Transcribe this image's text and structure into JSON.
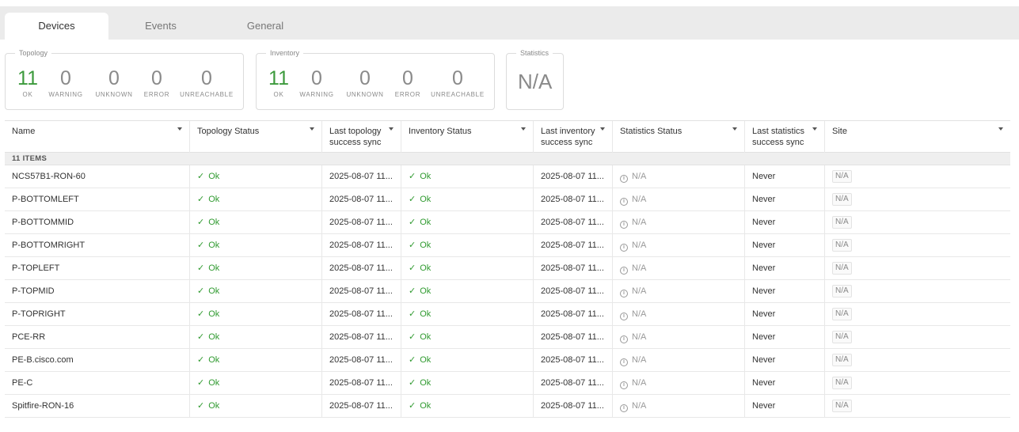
{
  "tabs": [
    {
      "label": "Devices",
      "active": true
    },
    {
      "label": "Events",
      "active": false
    },
    {
      "label": "General",
      "active": false
    }
  ],
  "topology": {
    "title": "Topology",
    "stats": [
      {
        "value": "11",
        "label": "OK"
      },
      {
        "value": "0",
        "label": "WARNING"
      },
      {
        "value": "0",
        "label": "UNKNOWN"
      },
      {
        "value": "0",
        "label": "ERROR"
      },
      {
        "value": "0",
        "label": "UNREACHABLE"
      }
    ]
  },
  "inventory": {
    "title": "Inventory",
    "stats": [
      {
        "value": "11",
        "label": "OK"
      },
      {
        "value": "0",
        "label": "WARNING"
      },
      {
        "value": "0",
        "label": "UNKNOWN"
      },
      {
        "value": "0",
        "label": "ERROR"
      },
      {
        "value": "0",
        "label": "UNREACHABLE"
      }
    ]
  },
  "statistics": {
    "title": "Statistics",
    "value": "N/A"
  },
  "table": {
    "columns": [
      {
        "line1": "Name",
        "line2": ""
      },
      {
        "line1": "Topology Status",
        "line2": ""
      },
      {
        "line1": "Last topology",
        "line2": "success sync"
      },
      {
        "line1": "Inventory Status",
        "line2": ""
      },
      {
        "line1": "Last inventory",
        "line2": "success sync"
      },
      {
        "line1": "Statistics Status",
        "line2": ""
      },
      {
        "line1": "Last statistics",
        "line2": "success sync"
      },
      {
        "line1": "Site",
        "line2": ""
      }
    ],
    "group_label": "11 ITEMS",
    "rows": [
      {
        "name": "NCS57B1-RON-60",
        "topology_status": "Ok",
        "last_topology_sync": "2025-08-07 11...",
        "inventory_status": "Ok",
        "last_inventory_sync": "2025-08-07 11...",
        "statistics_status": "N/A",
        "last_statistics_sync": "Never",
        "site": "N/A"
      },
      {
        "name": "P-BOTTOMLEFT",
        "topology_status": "Ok",
        "last_topology_sync": "2025-08-07 11...",
        "inventory_status": "Ok",
        "last_inventory_sync": "2025-08-07 11...",
        "statistics_status": "N/A",
        "last_statistics_sync": "Never",
        "site": "N/A"
      },
      {
        "name": "P-BOTTOMMID",
        "topology_status": "Ok",
        "last_topology_sync": "2025-08-07 11...",
        "inventory_status": "Ok",
        "last_inventory_sync": "2025-08-07 11...",
        "statistics_status": "N/A",
        "last_statistics_sync": "Never",
        "site": "N/A"
      },
      {
        "name": "P-BOTTOMRIGHT",
        "topology_status": "Ok",
        "last_topology_sync": "2025-08-07 11...",
        "inventory_status": "Ok",
        "last_inventory_sync": "2025-08-07 11...",
        "statistics_status": "N/A",
        "last_statistics_sync": "Never",
        "site": "N/A"
      },
      {
        "name": "P-TOPLEFT",
        "topology_status": "Ok",
        "last_topology_sync": "2025-08-07 11...",
        "inventory_status": "Ok",
        "last_inventory_sync": "2025-08-07 11...",
        "statistics_status": "N/A",
        "last_statistics_sync": "Never",
        "site": "N/A"
      },
      {
        "name": "P-TOPMID",
        "topology_status": "Ok",
        "last_topology_sync": "2025-08-07 11...",
        "inventory_status": "Ok",
        "last_inventory_sync": "2025-08-07 11...",
        "statistics_status": "N/A",
        "last_statistics_sync": "Never",
        "site": "N/A"
      },
      {
        "name": "P-TOPRIGHT",
        "topology_status": "Ok",
        "last_topology_sync": "2025-08-07 11...",
        "inventory_status": "Ok",
        "last_inventory_sync": "2025-08-07 11...",
        "statistics_status": "N/A",
        "last_statistics_sync": "Never",
        "site": "N/A"
      },
      {
        "name": "PCE-RR",
        "topology_status": "Ok",
        "last_topology_sync": "2025-08-07 11...",
        "inventory_status": "Ok",
        "last_inventory_sync": "2025-08-07 11...",
        "statistics_status": "N/A",
        "last_statistics_sync": "Never",
        "site": "N/A"
      },
      {
        "name": "PE-B.cisco.com",
        "topology_status": "Ok",
        "last_topology_sync": "2025-08-07 11...",
        "inventory_status": "Ok",
        "last_inventory_sync": "2025-08-07 11...",
        "statistics_status": "N/A",
        "last_statistics_sync": "Never",
        "site": "N/A"
      },
      {
        "name": "PE-C",
        "topology_status": "Ok",
        "last_topology_sync": "2025-08-07 11...",
        "inventory_status": "Ok",
        "last_inventory_sync": "2025-08-07 11...",
        "statistics_status": "N/A",
        "last_statistics_sync": "Never",
        "site": "N/A"
      },
      {
        "name": "Spitfire-RON-16",
        "topology_status": "Ok",
        "last_topology_sync": "2025-08-07 11...",
        "inventory_status": "Ok",
        "last_inventory_sync": "2025-08-07 11...",
        "statistics_status": "N/A",
        "last_statistics_sync": "Never",
        "site": "N/A"
      }
    ]
  },
  "icons": {
    "ok": "checkmark-icon",
    "na": "info-circle-icon",
    "sort": "caret-down-icon"
  },
  "colors": {
    "ok_green": "#2f9a2f",
    "muted_gray": "#8a8a8a",
    "tabbar_bg": "#ebebeb"
  }
}
